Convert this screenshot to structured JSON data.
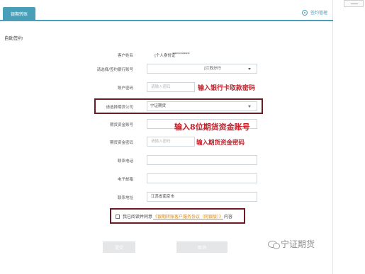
{
  "header": {
    "active_tab": "银期转账",
    "manage_link": "签约管理"
  },
  "section_title": "自助签约",
  "form": {
    "customer_name": {
      "label": "客户姓名",
      "id_type": "|个人身份证",
      "id_masked": "*********"
    },
    "bank_account": {
      "label": "请选择/签约银行账号",
      "branch": "|江苏分行"
    },
    "account_password": {
      "label": "账户密码",
      "placeholder": "请输入密码",
      "annotation": "输入银行卡取款密码"
    },
    "futures_company": {
      "label": "请选择期货公司",
      "value": "宁证期货"
    },
    "funds_account": {
      "label": "期货资金账号",
      "annotation": "输入8位期货资金账号"
    },
    "funds_password": {
      "label": "期货资金密码",
      "placeholder": "请输入密码",
      "annotation": "输入期货资金密码"
    },
    "phone": {
      "label": "联系电话"
    },
    "email": {
      "label": "电子邮箱"
    },
    "address": {
      "label": "联系地址",
      "value": "江苏省南京市"
    }
  },
  "agreement": {
    "prefix": "我已阅读并同意",
    "link": "《银期转账客户服务协议（网银版）》",
    "suffix": "内容"
  },
  "buttons": {
    "submit": "提交",
    "cancel": "取消"
  },
  "watermark": "宁证期货",
  "colors": {
    "accent": "#4a9fb8",
    "annotation_red": "#c8202b",
    "highlight_box": "#6e1a22",
    "agreement_link": "#e08a0b"
  }
}
